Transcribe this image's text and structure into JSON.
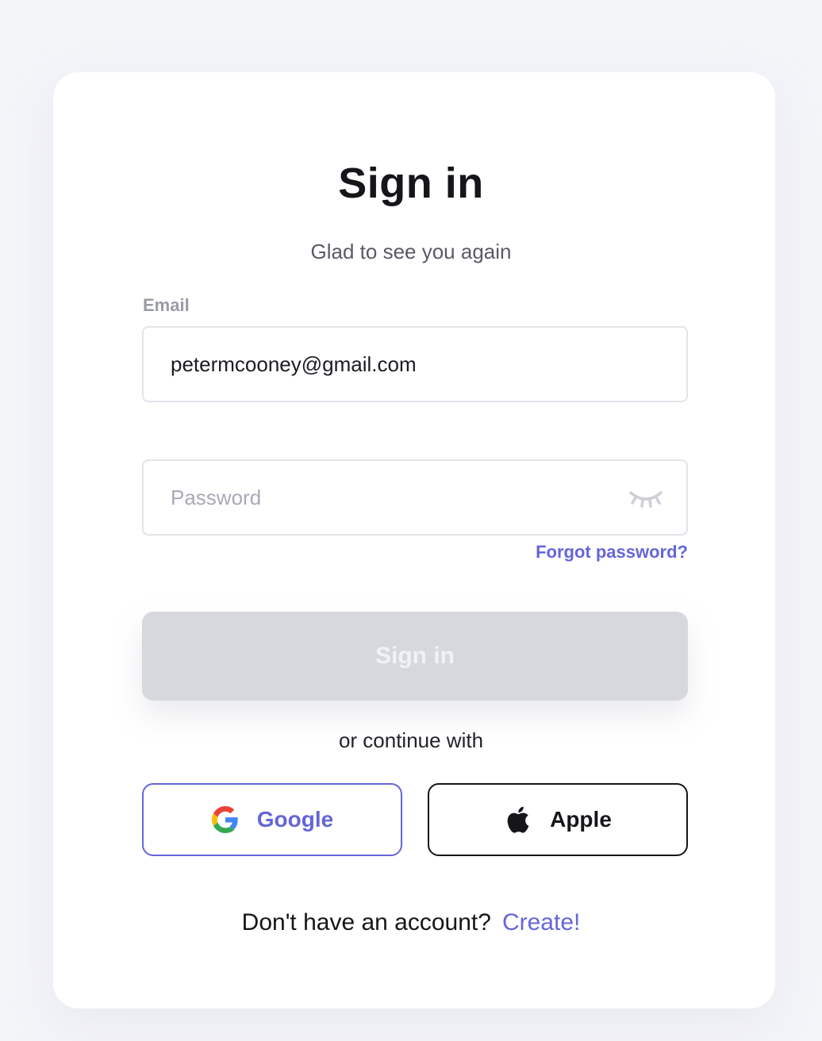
{
  "header": {
    "title": "Sign in",
    "subtitle": "Glad to see you again"
  },
  "email": {
    "label": "Email",
    "value": "petermcooney@gmail.com"
  },
  "password": {
    "placeholder": "Password",
    "toggle_icon": "eye-closed-icon",
    "forgot_label": "Forgot password?"
  },
  "signin_button": {
    "label": "Sign in",
    "disabled": true
  },
  "social": {
    "divider_text": "or continue with",
    "google_label": "Google",
    "google_icon": "google-g-icon",
    "apple_label": "Apple",
    "apple_icon": "apple-logo-icon"
  },
  "footer": {
    "prompt": "Don't have an account?",
    "link_label": "Create!"
  },
  "colors": {
    "accent": "#6566d9",
    "background": "#f4f5f9",
    "card": "#ffffff",
    "disabled_button": "#d7d8de"
  }
}
